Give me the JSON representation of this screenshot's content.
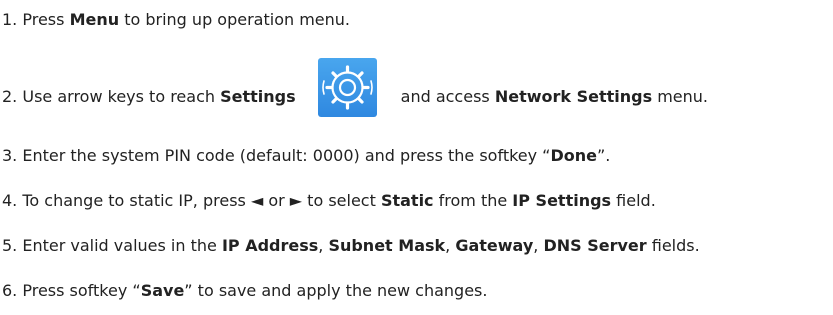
{
  "steps": [
    {
      "num": "1.",
      "parts": [
        "Press ",
        "Menu",
        " to bring up operation menu."
      ]
    },
    {
      "num": "2.",
      "parts": [
        "Use arrow keys to reach ",
        "Settings",
        "and access ",
        "Network Settings",
        " menu."
      ],
      "icon": "settings-gear-icon"
    },
    {
      "num": "3.",
      "parts": [
        "Enter the system PIN code (default: 0000) and press the softkey “",
        "Done",
        "”."
      ]
    },
    {
      "num": "4.",
      "parts": [
        "To change to static IP, press ◄ or ► to select ",
        "Static",
        " from the ",
        "IP Settings",
        " field."
      ]
    },
    {
      "num": "5.",
      "parts": [
        "Enter valid values in the ",
        "IP Address",
        ", ",
        "Subnet Mask",
        ", ",
        "Gateway",
        ", ",
        "DNS Server",
        " fields."
      ]
    },
    {
      "num": "6.",
      "parts": [
        "Press softkey “",
        "Save",
        "” to save and apply the new changes."
      ]
    }
  ],
  "colors": {
    "text": "#222222",
    "icon_bg": "#3b95e8",
    "icon_fg": "#ffffff"
  }
}
